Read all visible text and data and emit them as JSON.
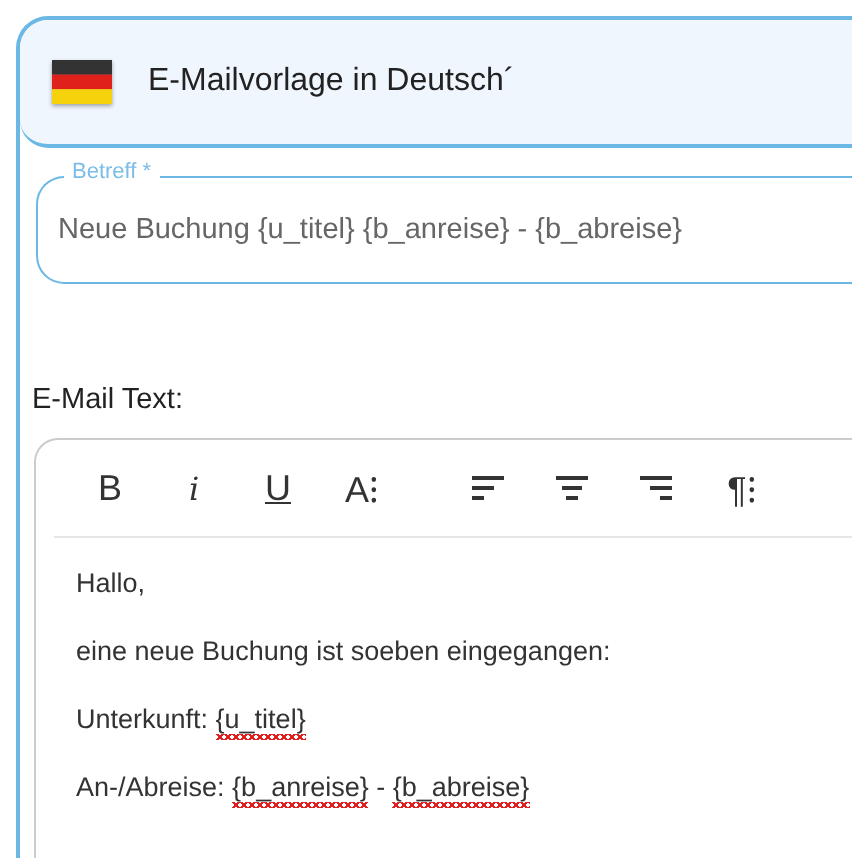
{
  "header": {
    "title": "E-Mailvorlage in Deutsch´"
  },
  "subject": {
    "label": "Betreff *",
    "value": "Neue Buchung {u_titel} {b_anreise} - {b_abreise}"
  },
  "body_label": "E-Mail Text:",
  "toolbar": [
    {
      "kind": "bold",
      "label": "B"
    },
    {
      "kind": "italic",
      "label": "i"
    },
    {
      "kind": "underline",
      "label": "U"
    },
    {
      "kind": "text",
      "label": "A⁝"
    },
    {
      "kind": "align-left"
    },
    {
      "kind": "align-center"
    },
    {
      "kind": "align-right"
    },
    {
      "kind": "text",
      "label": "¶⁝"
    }
  ],
  "content": [
    [
      {
        "text": "Hallo,",
        "misspelled": false
      }
    ],
    [
      {
        "text": "eine neue Buchung ist soeben eingegangen:",
        "misspelled": false
      }
    ],
    [
      {
        "text": "Unterkunft: ",
        "misspelled": false
      },
      {
        "text": "{u_titel}",
        "misspelled": true
      }
    ],
    [
      {
        "text": "An-/Abreise: ",
        "misspelled": false
      },
      {
        "text": "{b_anreise}",
        "misspelled": true
      },
      {
        "text": " - ",
        "misspelled": false
      },
      {
        "text": "{b_abreise}",
        "misspelled": true
      }
    ]
  ]
}
